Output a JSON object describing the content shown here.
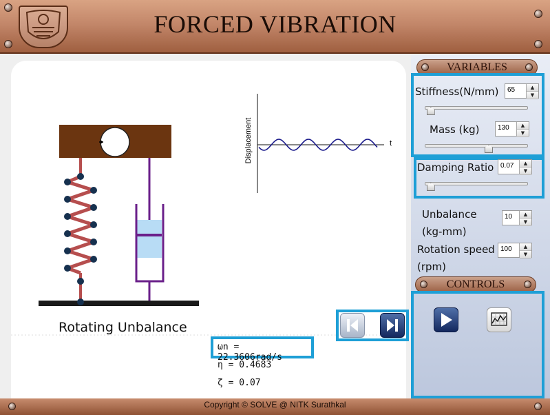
{
  "header": {
    "title": "FORCED VIBRATION"
  },
  "variables": {
    "title": "VARIABLES",
    "stiffness": {
      "label": "Stiffness(N/mm)",
      "value": "65",
      "slider_fraction": 0.02
    },
    "mass": {
      "label": "Mass (kg)",
      "value": "130",
      "slider_fraction": 0.63
    },
    "damping": {
      "label": "Damping Ratio",
      "value": "0.07",
      "slider_fraction": 0.02
    },
    "unbalance": {
      "label_line1": "Unbalance",
      "label_line2": "(kg-mm)",
      "value": "10"
    },
    "rotation": {
      "label_line1": "Rotation speed",
      "label_line2": "(rpm)",
      "value": "100"
    }
  },
  "controls": {
    "title": "CONTROLS",
    "play_icon": "play-icon",
    "graph_icon": "graph-icon"
  },
  "simulation": {
    "caption": "Rotating Unbalance",
    "graph_ylabel": "Displacement",
    "graph_xlabel": "t",
    "wn": "ωn = 22.3606rad/s",
    "eta": "η = 0.4683",
    "zeta": "ζ = 0.07"
  },
  "footer": {
    "copyright": "Copyright © SOLVE @ NITK Surathkal"
  },
  "colors": {
    "highlight": "#1e9fd6",
    "spring": "#b64e4e",
    "mass_block": "#6b3510",
    "damper": "#6a1f8a",
    "wave": "#1c1c8c"
  }
}
